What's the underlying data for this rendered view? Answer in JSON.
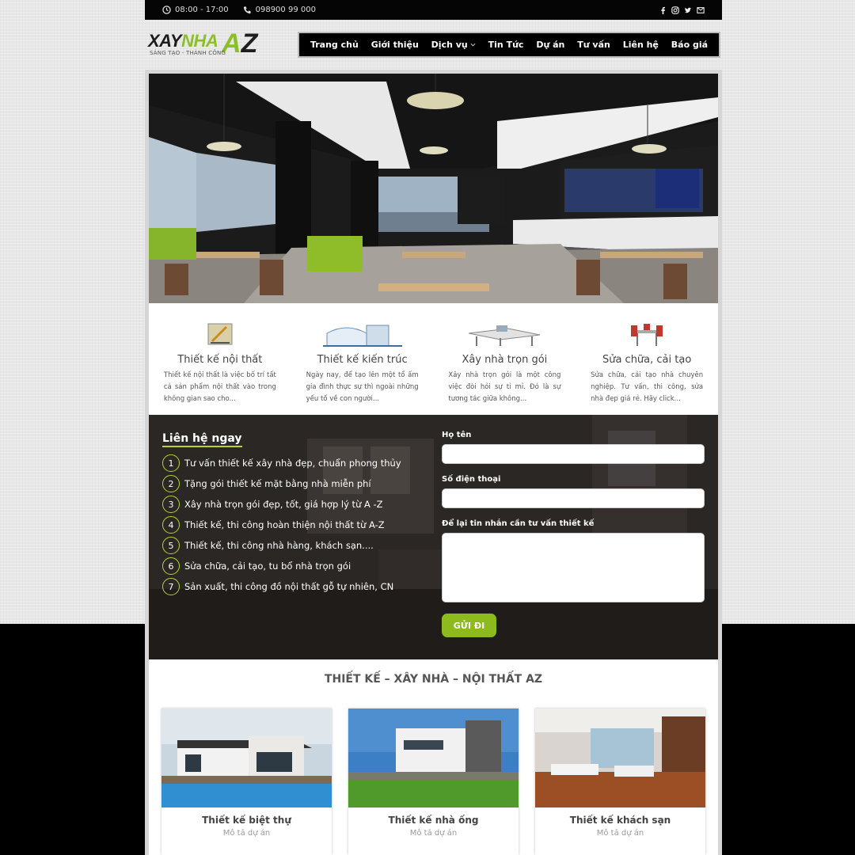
{
  "topbar": {
    "hours": "08:00 - 17:00",
    "phone": "098900 99 000"
  },
  "logo": {
    "text_dark": "XAY",
    "text_green": "NHA",
    "az_a": "A",
    "az_z": "Z",
    "tagline": "SÁNG TẠO - THÀNH CÔNG"
  },
  "nav": [
    {
      "label": "Trang chủ"
    },
    {
      "label": "Giới thiệu"
    },
    {
      "label": "Dịch vụ"
    },
    {
      "label": "Tin Tức"
    },
    {
      "label": "Dự án"
    },
    {
      "label": "Tư vấn"
    },
    {
      "label": "Liên hệ"
    },
    {
      "label": "Báo giá"
    }
  ],
  "services": [
    {
      "title": "Thiết kế nội thất",
      "text": "Thiết kế nội thất là việc bố trí tất cả sản phẩm nội thất vào trong không gian sao cho..."
    },
    {
      "title": "Thiết kế kiến trúc",
      "text": "Ngày nay, để tạo lên một tổ ấm gia đình thực sự thì ngoài những yếu tố về con người..."
    },
    {
      "title": "Xây nhà trọn gói",
      "text": "Xây nhà trọn gói là một công việc đòi hỏi sự tỉ mỉ. Đó là sự tương tác giữa không..."
    },
    {
      "title": "Sửa chữa, cải tạo",
      "text": "Sửa chữa, cải tạo nhà chuyên nghiệp. Tư vấn, thi công, sửa nhà đẹp giá rẻ. Hãy click..."
    }
  ],
  "contact": {
    "title": "Liên hệ ngay",
    "items": [
      {
        "n": "1",
        "text": "Tư vấn thiết kế xây nhà đẹp, chuẩn phong thủy"
      },
      {
        "n": "2",
        "text": "Tặng gói thiết kế mặt bằng nhà miễn phí"
      },
      {
        "n": "3",
        "text": "Xây nhà trọn gói đẹp, tốt, giá hợp lý từ A -Z"
      },
      {
        "n": "4",
        "text": "Thiết kế, thi công hoàn thiện nội thất từ A-Z"
      },
      {
        "n": "5",
        "text": "Thiết kế, thi công nhà hàng, khách sạn...."
      },
      {
        "n": "6",
        "text": "Sửa chữa, cải tạo, tu bổ nhà trọn gói"
      },
      {
        "n": "7",
        "text": "Sản xuất, thi công đồ nội thất gỗ tự nhiên, CN"
      }
    ],
    "form": {
      "name_label": "Họ tên",
      "phone_label": "Số điện thoại",
      "message_label": "Để lại tin nhắn cần tư vấn thiết kế",
      "submit": "GỬI ĐI"
    }
  },
  "projects": {
    "heading": "THIẾT KẾ – XÂY NHÀ – NỘI THẤT AZ",
    "cards": [
      {
        "title": "Thiết kế biệt thự",
        "sub": "Mô tả dự án"
      },
      {
        "title": "Thiết kế nhà ống",
        "sub": "Mô tả dự án"
      },
      {
        "title": "Thiết kế khách sạn",
        "sub": "Mô tả dự án"
      }
    ]
  },
  "colors": {
    "accent": "#8dbb1e",
    "accent_ring": "#b7d433",
    "topbar": "#050505"
  }
}
